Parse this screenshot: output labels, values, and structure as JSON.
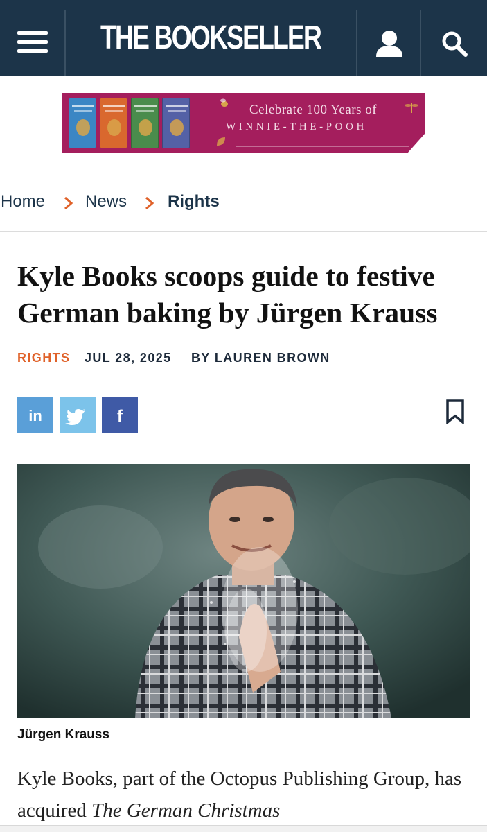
{
  "header": {
    "logo_text": "THE BOOKSELLER",
    "background": "#1c3449",
    "menu_icon": "hamburger-menu-icon",
    "account_icon": "user-icon",
    "search_icon": "search-icon"
  },
  "ad": {
    "headline": "Celebrate 100 Years of",
    "subline": "WINNIE-THE-POOH",
    "background": "#a41e5d"
  },
  "breadcrumb": {
    "items": [
      {
        "label": "Home"
      },
      {
        "label": "News"
      },
      {
        "label": "Rights"
      }
    ],
    "separator_color": "#e0622a"
  },
  "article": {
    "title": "Kyle Books scoops guide to festive German baking by Jürgen Krauss",
    "category": "RIGHTS",
    "date": "JUL 28, 2025",
    "byline": "BY LAUREN BROWN",
    "accent_color": "#e0622a",
    "share": [
      {
        "network": "LinkedIn",
        "glyph": "in",
        "color": "#5a9fd8"
      },
      {
        "network": "Twitter",
        "glyph": "twitter-bird-icon",
        "color": "#7cc3ea"
      },
      {
        "network": "Facebook",
        "glyph": "f",
        "color": "#3f5aa6"
      }
    ],
    "image_caption": "Jürgen Krauss",
    "body_start": "Kyle Books, part of the Octopus Publishing Group, has acquired",
    "body_italic": "The German Christmas"
  }
}
